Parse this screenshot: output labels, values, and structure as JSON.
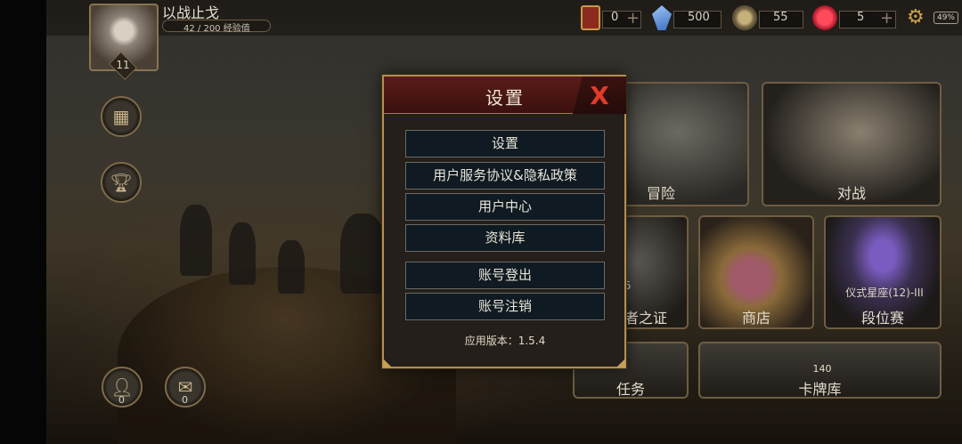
{
  "player": {
    "name": "以战止戈",
    "exp": "42 / 200 经验值",
    "level": "11"
  },
  "resources": {
    "cards": "0",
    "crystals": "500",
    "coins": "55",
    "gems": "5",
    "battery": "49%"
  },
  "side_buttons": {
    "friends_count": "0",
    "mail_count": "0"
  },
  "tiles": {
    "adventure": "冒险",
    "battle": "对战",
    "proof": "者之证",
    "proof_badge": "5",
    "shop": "商店",
    "ranked": "段位赛",
    "ranked_rank": "仪式星座(12)-III",
    "quests": "任务",
    "collection": "卡牌库",
    "collection_count": "140"
  },
  "modal": {
    "title": "设置",
    "close_symbol": "X",
    "items": [
      "设置",
      "用户服务协议&隐私政策",
      "用户中心",
      "资料库",
      "账号登出",
      "账号注销"
    ],
    "version": "应用版本：1.5.4"
  },
  "colors": {
    "accent_gold": "#b18f52",
    "header_red": "#5a1c18",
    "close_red": "#e13a2a",
    "button_bg": "#0f1a22"
  }
}
